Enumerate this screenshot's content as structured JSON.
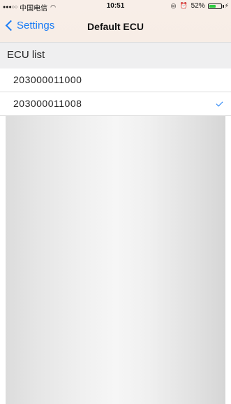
{
  "status_bar": {
    "signal": "●●●○○",
    "carrier": "中国电信",
    "wifi_icon": "wifi-icon",
    "time": "10:51",
    "location_icon": "location-icon",
    "alarm_icon": "alarm-icon",
    "battery_percent": "52%",
    "battery_level": 0.52,
    "charging_icon": "charging-icon"
  },
  "nav": {
    "back_label": "Settings",
    "title": "Default ECU"
  },
  "section": {
    "header": "ECU list"
  },
  "ecu_list": [
    {
      "label": "203000011000",
      "selected": false
    },
    {
      "label": "203000011008",
      "selected": true
    }
  ],
  "colors": {
    "accent": "#1a7cf5",
    "header_bg": "#f7ede6",
    "section_bg": "#efeff0"
  }
}
